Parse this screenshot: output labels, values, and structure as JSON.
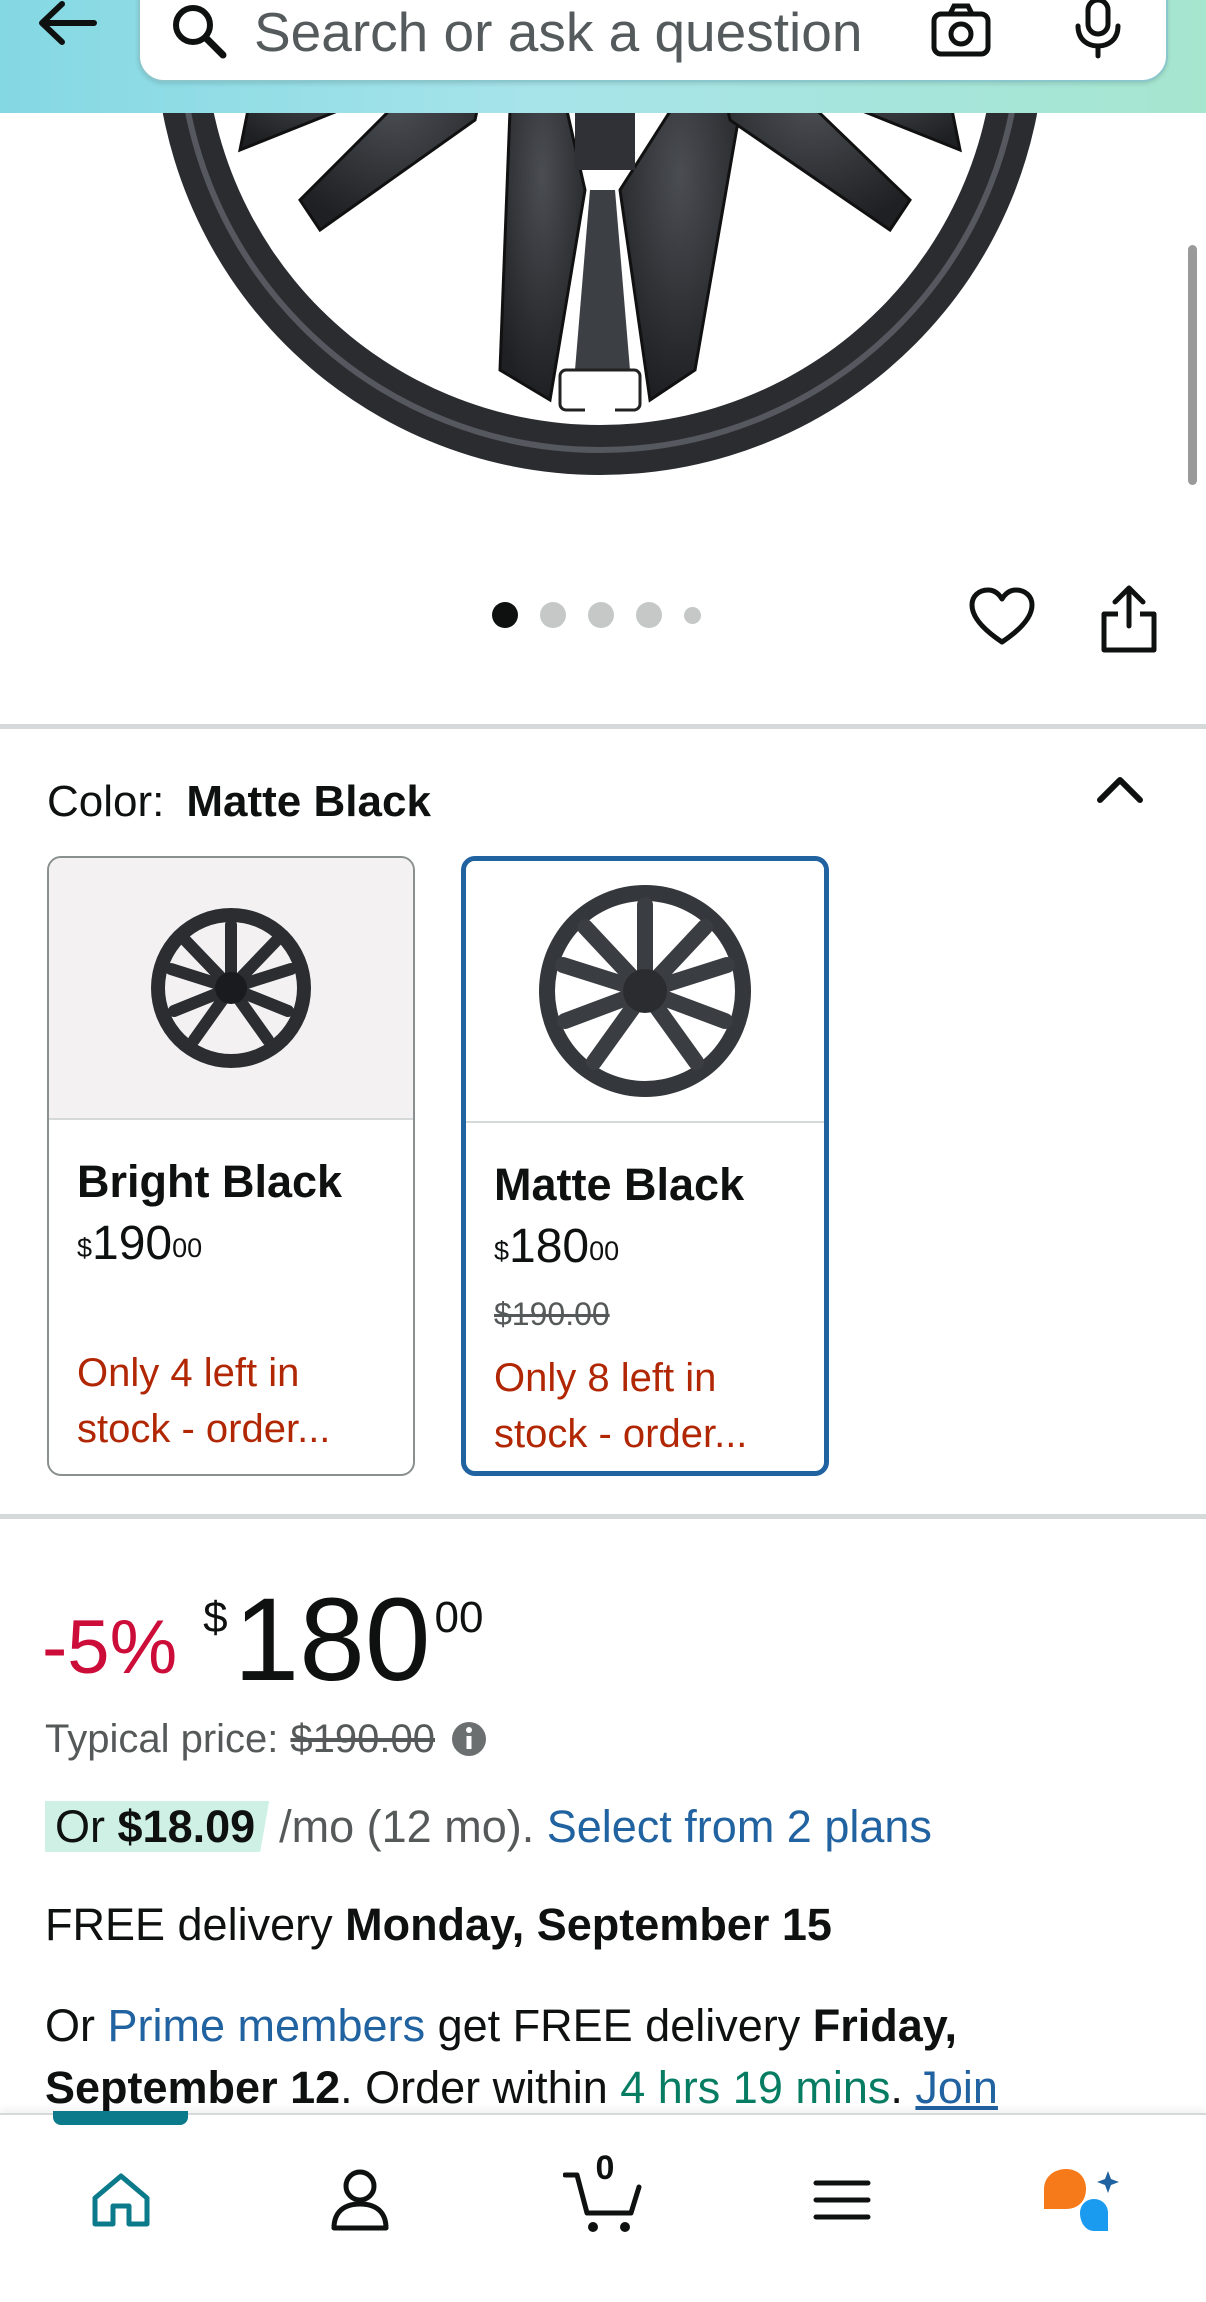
{
  "header": {
    "search_placeholder": "Search or ask a question"
  },
  "gallery": {
    "image_count": 5,
    "active_index": 0
  },
  "color_section": {
    "label": "Color:",
    "selected_value": "Matte Black",
    "options": [
      {
        "name": "Bright Black",
        "currency": "$",
        "whole": "190",
        "fraction": "00",
        "strike_price": "",
        "stock": "Only 4 left in stock - order..."
      },
      {
        "name": "Matte Black",
        "currency": "$",
        "whole": "180",
        "fraction": "00",
        "strike_price": "$190.00",
        "stock": "Only 8 left in stock - order..."
      }
    ]
  },
  "price": {
    "discount": "-5%",
    "currency": "$",
    "whole": "180",
    "fraction": "00",
    "typical_label": "Typical price:",
    "typical_value": "$190.00"
  },
  "installment": {
    "prefix": "Or",
    "amount": "$18.09",
    "term": "/mo (12 mo).",
    "link": "Select from 2 plans"
  },
  "delivery": {
    "prefix": "FREE delivery",
    "date": "Monday, September 15"
  },
  "prime_delivery": {
    "prefix": "Or",
    "link": "Prime members",
    "middle": "get FREE delivery",
    "date": "Friday, September 12",
    "order_within_prefix": ". Order within",
    "countdown": "4 hrs 19 mins",
    "period": ".",
    "join": "Join"
  },
  "bottom_nav": {
    "cart_count": "0",
    "items": [
      "home-icon",
      "account-icon",
      "cart-icon",
      "menu-icon",
      "rufus-icon"
    ]
  },
  "colors": {
    "link": "#2162A1",
    "discount": "#CC0C39",
    "stock": "#B12704",
    "countdown": "#067D62",
    "selected_border": "#2162A1",
    "home_active": "#0b7b8b"
  }
}
